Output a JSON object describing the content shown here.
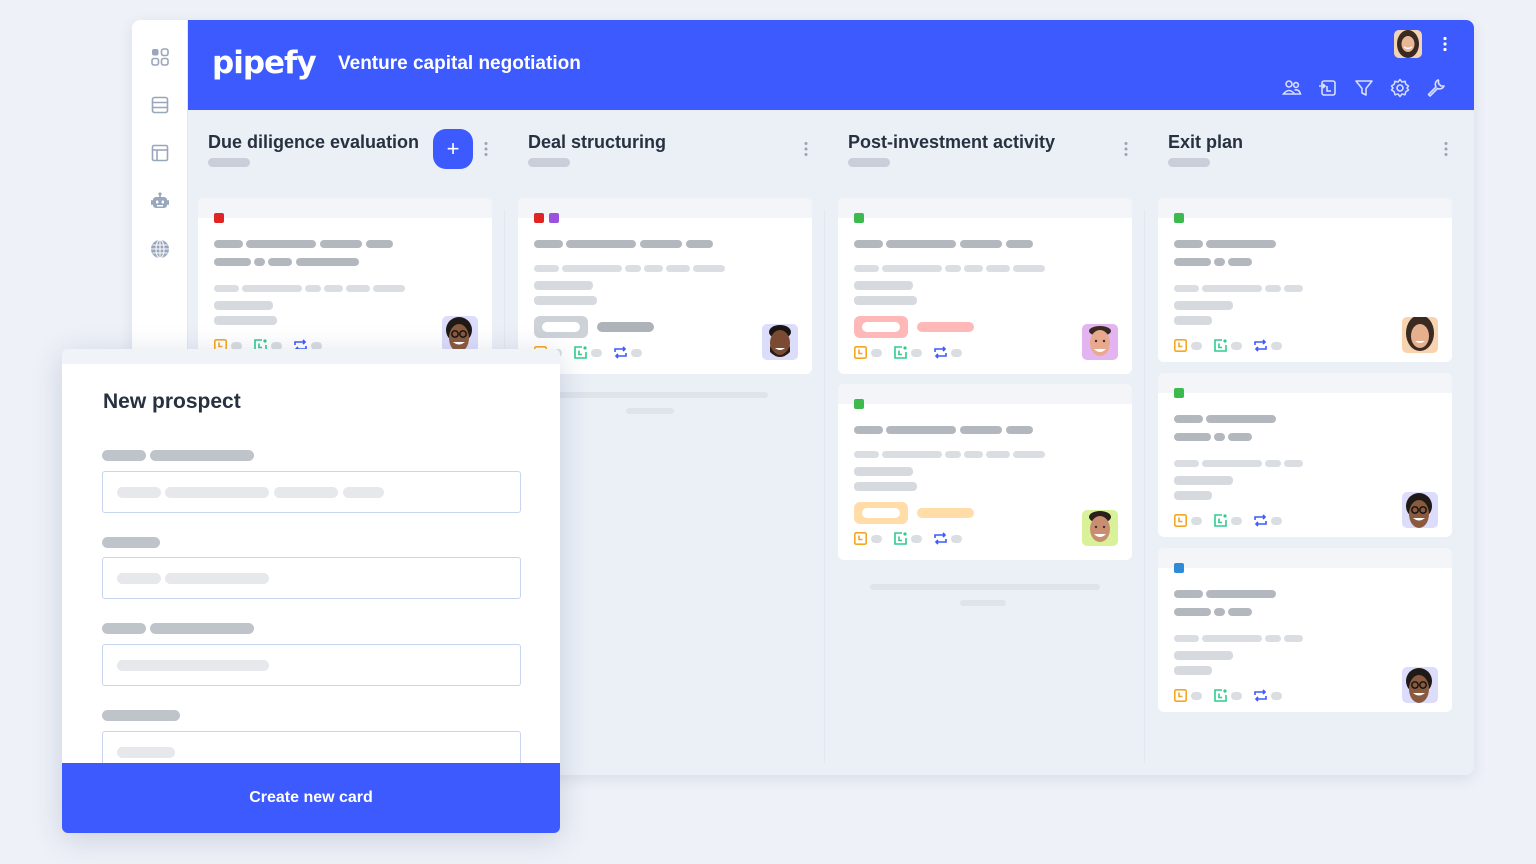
{
  "app": {
    "logo": "pipefy",
    "pipe_title": "Venture capital negotiation"
  },
  "sidebar": {
    "items": [
      {
        "icon": "apps-grid-icon"
      },
      {
        "icon": "database-icon"
      },
      {
        "icon": "layout-icon"
      },
      {
        "icon": "robot-icon"
      },
      {
        "icon": "globe-icon"
      }
    ]
  },
  "header": {
    "actions": [
      "members-icon",
      "import-icon",
      "filter-icon",
      "settings-gear-icon",
      "wrench-icon"
    ]
  },
  "columns": [
    {
      "title": "Due diligence evaluation",
      "add_label": "+",
      "cards": [
        {
          "tags": [
            "#e02424"
          ],
          "avatar": "avatar-woman-glasses",
          "pill": null
        }
      ]
    },
    {
      "title": "Deal structuring",
      "cards": [
        {
          "tags": [
            "#e02424",
            "#9b51e0"
          ],
          "avatar": "avatar-man-beard",
          "pill": "#cdd1d8"
        }
      ]
    },
    {
      "title": "Post-investment activity",
      "cards": [
        {
          "tags": [
            "#3dba4e"
          ],
          "avatar": "avatar-man-smiling",
          "pill": "#ffb8b8"
        },
        {
          "tags": [
            "#3dba4e"
          ],
          "avatar": "avatar-man-short-hair",
          "pill": "#ffdca8"
        }
      ]
    },
    {
      "title": "Exit plan",
      "cards": [
        {
          "tags": [
            "#3dba4e"
          ],
          "avatar": "avatar-woman-smiling",
          "pill": null
        },
        {
          "tags": [
            "#3dba4e"
          ],
          "avatar": "avatar-woman-glasses",
          "pill": null
        },
        {
          "tags": [
            "#2f8ad8"
          ],
          "avatar": "avatar-woman-glasses",
          "pill": null
        }
      ]
    }
  ],
  "modal": {
    "title": "New prospect",
    "submit_label": "Create new card"
  },
  "colors": {
    "brand": "#3d5afe",
    "clock_icon": "#f5a623",
    "checklist_icon": "#2ecc8f",
    "sync_icon": "#3d5afe"
  }
}
